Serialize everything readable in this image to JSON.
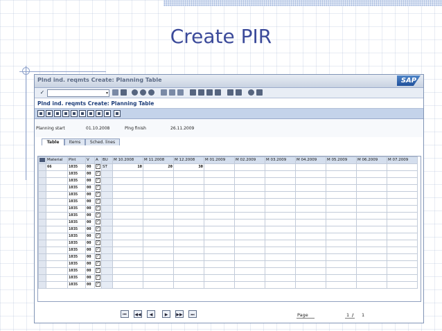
{
  "slide": {
    "title": "Create PIR"
  },
  "window": {
    "title": "Plnd ind. reqmts Create: Planning Table",
    "subtitle": "Plnd ind. reqmts Create: Planning Table",
    "logo": "SAP"
  },
  "toolbar": {
    "ok_glyph": "✓",
    "command_value": "",
    "dropdown_glyph": "▾"
  },
  "header": {
    "planning_start_label": "Planning start",
    "planning_start_value": "01.10.2008",
    "planning_finish_label": "Plng finish",
    "planning_finish_value": "26.11.2009"
  },
  "tabs": [
    {
      "label": "Table",
      "active": true
    },
    {
      "label": "Items",
      "active": false
    },
    {
      "label": "Sched. lines",
      "active": false
    }
  ],
  "table": {
    "columns": [
      "Material",
      "Plnt",
      "V",
      "A",
      "BU",
      "M 10.2008",
      "M 11.2008",
      "M 12.2008",
      "M 01.2009",
      "M 02.2009",
      "M 03.2009",
      "M 04.2009",
      "M 05.2009",
      "M 06.2009",
      "M 07.2009"
    ],
    "rows": [
      {
        "material": "66",
        "plant": "1035",
        "version": "00",
        "active": "✓",
        "unit": "ST",
        "m10_2008": "10",
        "m11_2008": "20",
        "m12_2008": "30"
      },
      {
        "material": "",
        "plant": "1035",
        "version": "00",
        "active": "✓",
        "unit": "",
        "m10_2008": "",
        "m11_2008": "",
        "m12_2008": ""
      },
      {
        "material": "",
        "plant": "1035",
        "version": "00",
        "active": "✓",
        "unit": "",
        "m10_2008": "",
        "m11_2008": "",
        "m12_2008": ""
      },
      {
        "material": "",
        "plant": "1035",
        "version": "00",
        "active": "✓",
        "unit": "",
        "m10_2008": "",
        "m11_2008": "",
        "m12_2008": ""
      },
      {
        "material": "",
        "plant": "1035",
        "version": "00",
        "active": "✓",
        "unit": "",
        "m10_2008": "",
        "m11_2008": "",
        "m12_2008": ""
      },
      {
        "material": "",
        "plant": "1035",
        "version": "00",
        "active": "✓",
        "unit": "",
        "m10_2008": "",
        "m11_2008": "",
        "m12_2008": ""
      },
      {
        "material": "",
        "plant": "1035",
        "version": "00",
        "active": "✓",
        "unit": "",
        "m10_2008": "",
        "m11_2008": "",
        "m12_2008": ""
      },
      {
        "material": "",
        "plant": "1035",
        "version": "00",
        "active": "✓",
        "unit": "",
        "m10_2008": "",
        "m11_2008": "",
        "m12_2008": ""
      },
      {
        "material": "",
        "plant": "1035",
        "version": "00",
        "active": "✓",
        "unit": "",
        "m10_2008": "",
        "m11_2008": "",
        "m12_2008": ""
      },
      {
        "material": "",
        "plant": "1035",
        "version": "00",
        "active": "✓",
        "unit": "",
        "m10_2008": "",
        "m11_2008": "",
        "m12_2008": ""
      },
      {
        "material": "",
        "plant": "1035",
        "version": "00",
        "active": "✓",
        "unit": "",
        "m10_2008": "",
        "m11_2008": "",
        "m12_2008": ""
      },
      {
        "material": "",
        "plant": "1035",
        "version": "00",
        "active": "✓",
        "unit": "",
        "m10_2008": "",
        "m11_2008": "",
        "m12_2008": ""
      },
      {
        "material": "",
        "plant": "1035",
        "version": "00",
        "active": "✓",
        "unit": "",
        "m10_2008": "",
        "m11_2008": "",
        "m12_2008": ""
      },
      {
        "material": "",
        "plant": "1035",
        "version": "00",
        "active": "✓",
        "unit": "",
        "m10_2008": "",
        "m11_2008": "",
        "m12_2008": ""
      },
      {
        "material": "",
        "plant": "1035",
        "version": "00",
        "active": "✓",
        "unit": "",
        "m10_2008": "",
        "m11_2008": "",
        "m12_2008": ""
      },
      {
        "material": "",
        "plant": "1035",
        "version": "00",
        "active": "✓",
        "unit": "",
        "m10_2008": "",
        "m11_2008": "",
        "m12_2008": ""
      },
      {
        "material": "",
        "plant": "1035",
        "version": "00",
        "active": "✓",
        "unit": "",
        "m10_2008": "",
        "m11_2008": "",
        "m12_2008": ""
      },
      {
        "material": "",
        "plant": "1035",
        "version": "00",
        "active": "✓",
        "unit": "",
        "m10_2008": "",
        "m11_2008": "",
        "m12_2008": ""
      }
    ]
  },
  "pager": {
    "buttons": [
      "⏮",
      "◀◀",
      "◀",
      "▶",
      "▶▶",
      "⏭"
    ],
    "page_label": "Page",
    "page_current": "1",
    "page_separator": "/",
    "page_total": "1"
  },
  "icons": {
    "toolbar": [
      "back-icon",
      "save-icon",
      "exit-icon",
      "cancel-icon",
      "print-icon",
      "find-icon",
      "find-next-icon",
      "first-page-icon",
      "prev-page-icon",
      "next-page-icon",
      "last-page-icon",
      "new-session-icon",
      "shortcut-icon",
      "help-icon",
      "layout-icon"
    ],
    "application": [
      "sched-lines-icon",
      "mass-change-icon",
      "distribute-icon",
      "delete-icon",
      "table-icon",
      "select-icon",
      "tools-icon",
      "detail-icon",
      "item-icon",
      "export-icon"
    ]
  }
}
